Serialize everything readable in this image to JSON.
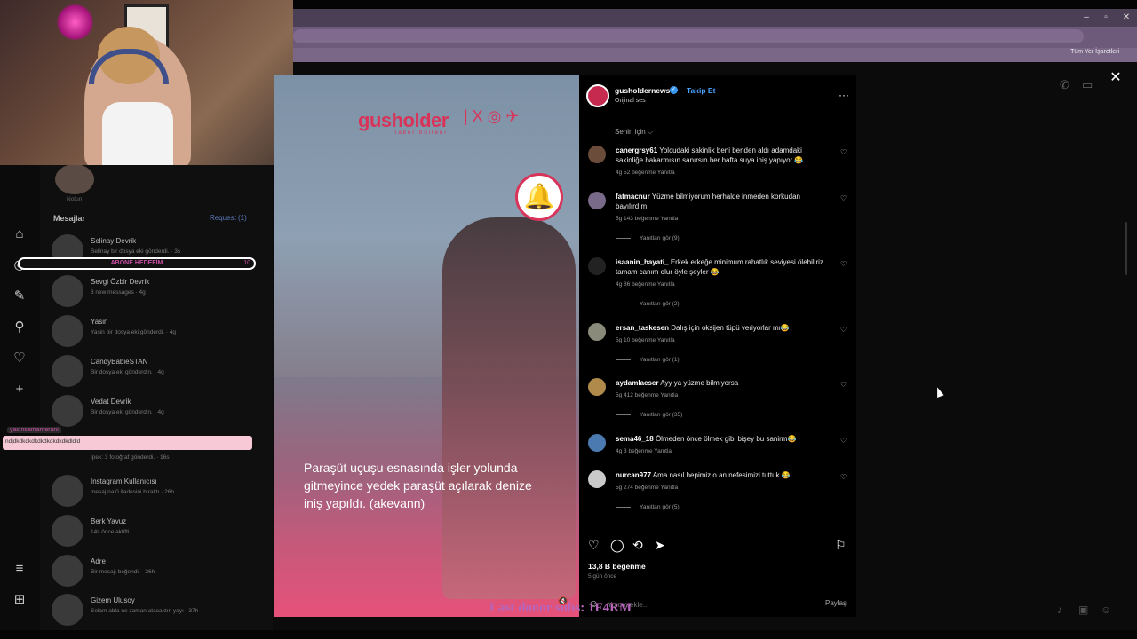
{
  "browser": {
    "window_controls": [
      "–",
      "▫",
      "✕"
    ],
    "bookmarks_label": "Tüm Yer İşaretleri"
  },
  "sidebar_rail": {
    "icons": [
      "home-icon",
      "messenger-icon",
      "threads-icon",
      "search-icon",
      "heart-icon",
      "plus-icon",
      "menu-icon",
      "grid-icon"
    ]
  },
  "messages": {
    "title": "Mesajlar",
    "request": "Request (1)",
    "note_label": "Notun",
    "threads": [
      {
        "name": "Selinay Devrik",
        "sub": "Selinay bir dosya eki gönderdi. · 3s"
      },
      {
        "name": "Sevgi Özbir Devrik",
        "sub": "3 new messages · 4g"
      },
      {
        "name": "Yasin",
        "sub": "Yasin bir dosya eki gönderdi. · 4g"
      },
      {
        "name": "CandyBabieSTAN",
        "sub": "Bir dosya eki gönderdin. · 4g"
      },
      {
        "name": "Vedat Devrik",
        "sub": "Bir dosya eki gönderdin. · 4g"
      },
      {
        "name": "",
        "sub": "İpek: 3 fotoğraf gönderdi. · 16s"
      },
      {
        "name": "Instagram Kullanıcısı",
        "sub": "mesajına 0 ifadesini bıraktı · 26h"
      },
      {
        "name": "Berk Yavuz",
        "sub": "14s önce aktifti"
      },
      {
        "name": "Adre",
        "sub": "Bir mesajı beğendi. · 26h"
      },
      {
        "name": "Gizem Ulusoy",
        "sub": "Selam abla ne zaman atacaktın yayı · 37h"
      }
    ]
  },
  "stream_overlay": {
    "goal_label": "ABONE HEDEFİM",
    "goal_count": "10",
    "chat_user": "yasinsamamerani",
    "chat_message": "ndjdkdkdkdkdkdkdkdkdkdldld",
    "donor_text": "Last donor subs: 1F4RM"
  },
  "post": {
    "username": "gusholdernews",
    "verified_mark": "✓",
    "follow_label": "Takip Et",
    "audio": "Orijinal ses",
    "more": "···",
    "brand_logo": "gusholder",
    "brand_sub": "haber bülteni",
    "brand_social": "| X ◎ ✈",
    "bell": "🔔",
    "caption": "Paraşüt uçuşu esnasında işler yolunda gitmeyince yedek paraşüt açılarak denize iniş yapıldı. (akevann)",
    "mute": "🔇",
    "for_you": "Senin için ⌵",
    "comments": [
      {
        "user": "canergrsy61",
        "text": "Yolcudaki sakinlik beni benden aldı adamdaki sakinliğe bakarmısın sanırsın her hafta suya iniş yapıyor 😂",
        "meta": "4g   52 beğenme   Yanıtla",
        "replies": ""
      },
      {
        "user": "fatmacnur",
        "text": "Yüzme bilmiyorum herhalde inmeden korkudan bayılırdım",
        "meta": "5g   143 beğenme   Yanıtla",
        "replies": "Yanıtları gör (9)"
      },
      {
        "user": "isaanin_hayati_",
        "text": "Erkek erkeğe minimum rahatlık seviyesi ölebiliriz tamam canım olur öyle şeyler 😂",
        "meta": "4g   86 beğenme   Yanıtla",
        "replies": "Yanıtları gör (2)"
      },
      {
        "user": "ersan_taskesen",
        "text": "Dalış için oksijen tüpü veriyorlar mı😂",
        "meta": "5g   10 beğenme   Yanıtla",
        "replies": "Yanıtları gör (1)"
      },
      {
        "user": "aydamlaeser",
        "text": "Ayy ya yüzme bilmiyorsa",
        "meta": "5g   412 beğenme   Yanıtla",
        "replies": "Yanıtları gör (35)"
      },
      {
        "user": "sema46_18",
        "text": "Ölmeden önce ölmek gibi bişey bu sanirm😂",
        "meta": "4g   3 beğenme   Yanıtla",
        "replies": ""
      },
      {
        "user": "nurcan977",
        "text": "Ama nasıl hepimiz o an nefesimizi tuttuk 😂",
        "meta": "5g   274 beğenme   Yanıtla",
        "replies": "Yanıtları gör (5)"
      }
    ],
    "likes": "13,8 B beğenme",
    "ago": "5 gün önce",
    "comment_placeholder": "Yorum ekle...",
    "share_label": "Paylaş",
    "close": "✕"
  },
  "colors": {
    "accent": "#d8345a",
    "link": "#4aa3ff",
    "overlay_pink": "#c84fa3"
  }
}
